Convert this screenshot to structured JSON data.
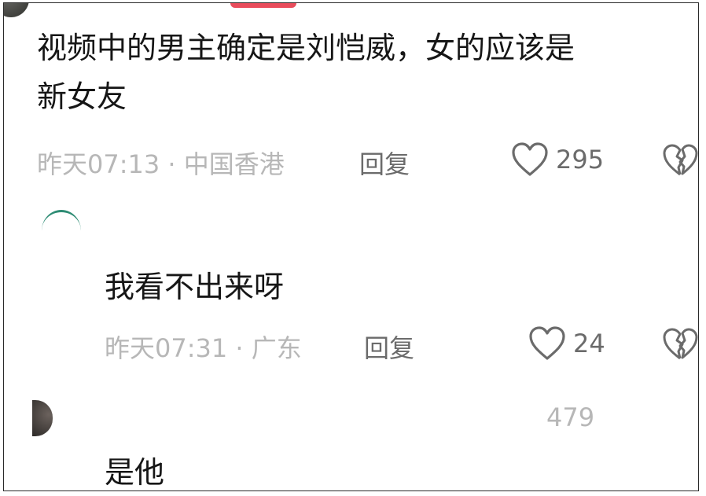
{
  "comments": [
    {
      "text_lines": [
        "视频中的男主确定是刘恺威，女的应该是",
        "新女友"
      ],
      "meta": "昨天07:13 · 中国香港",
      "reply_label": "回复",
      "likes": "295"
    },
    {
      "text_lines": [
        "我看不出来呀"
      ],
      "meta": "昨天07:31 · 广东",
      "reply_label": "回复",
      "likes": "24"
    },
    {
      "text_lines": [
        "是他"
      ],
      "likes": "479"
    }
  ],
  "icons": {
    "like": "heart-outline-icon",
    "dislike": "broken-heart-icon"
  },
  "colors": {
    "text": "#161616",
    "meta": "#b7b7b7",
    "action": "#6b6b6b",
    "badge": "#e94d5c",
    "avatar_ring": "#2e8c74"
  }
}
